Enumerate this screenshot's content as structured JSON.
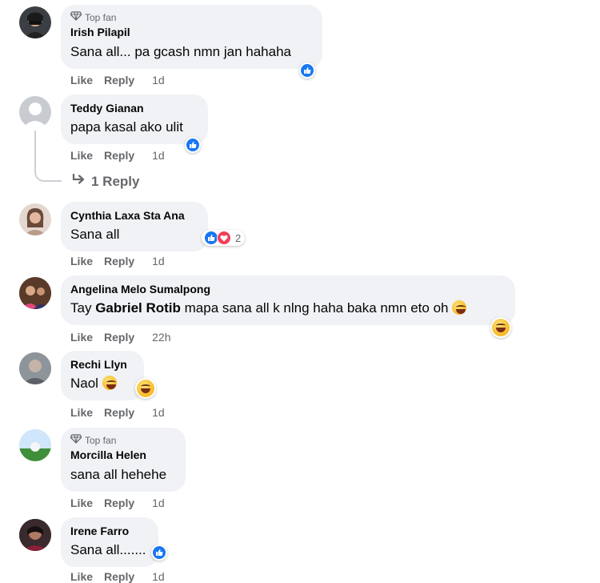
{
  "comments": [
    {
      "badge": "Top fan",
      "author": "Irish Pilapil",
      "text": "Sana all... pa gcash nmn jan hahaha",
      "like": "Like",
      "reply": "Reply",
      "time": "1d"
    },
    {
      "author": "Teddy Gianan",
      "text": "papa kasal ako ulit",
      "like": "Like",
      "reply": "Reply",
      "time": "1d",
      "replies_link": "1 Reply"
    },
    {
      "author": "Cynthia Laxa Sta Ana",
      "text": "Sana all",
      "like": "Like",
      "reply": "Reply",
      "time": "1d",
      "reaction_count": "2"
    },
    {
      "author": "Angelina Melo Sumalpong",
      "mention": "Gabriel Rotib",
      "text_before": "Tay ",
      "text_after": " mapa sana all k nlng haha baka nmn eto oh",
      "like": "Like",
      "reply": "Reply",
      "time": "22h"
    },
    {
      "author": "Rechi Llyn",
      "text": "Naol",
      "like": "Like",
      "reply": "Reply",
      "time": "1d"
    },
    {
      "badge": "Top fan",
      "author": "Morcilla Helen",
      "text": "sana all hehehe",
      "like": "Like",
      "reply": "Reply",
      "time": "1d"
    },
    {
      "author": "Irene Farro",
      "text": "Sana all.......",
      "like": "Like",
      "reply": "Reply",
      "time": "1d"
    }
  ],
  "colors": {
    "like_blue": "#1877f2",
    "love_red": "#f33e58",
    "bubble": "#f0f2f5",
    "meta_gray": "#65676b"
  },
  "icons": [
    "top-fan-diamond-icon",
    "like-reaction-icon",
    "love-reaction-icon",
    "haha-emoji-icon",
    "reply-arrow-icon"
  ]
}
